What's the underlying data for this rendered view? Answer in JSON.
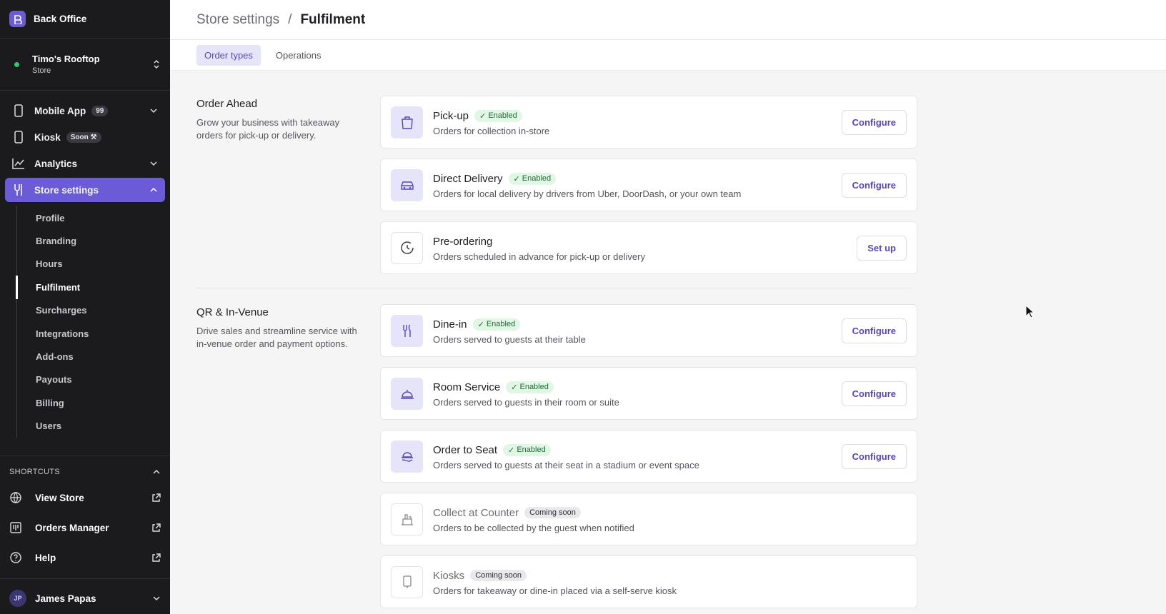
{
  "brand": {
    "name": "Back Office"
  },
  "store": {
    "name": "Timo's Rooftop",
    "type": "Store"
  },
  "nav": {
    "mobile_app": {
      "label": "Mobile App",
      "badge": "99"
    },
    "kiosk": {
      "label": "Kiosk",
      "badge": "Soon"
    },
    "analytics": {
      "label": "Analytics"
    },
    "store_settings": {
      "label": "Store settings"
    }
  },
  "subnav": [
    "Profile",
    "Branding",
    "Hours",
    "Fulfilment",
    "Surcharges",
    "Integrations",
    "Add-ons",
    "Payouts",
    "Billing",
    "Users"
  ],
  "shortcuts": {
    "header": "SHORTCUTS",
    "items": [
      "View Store",
      "Orders Manager",
      "Help"
    ]
  },
  "user": {
    "name": "James Papas",
    "initials": "JP"
  },
  "breadcrumb": {
    "parent": "Store settings",
    "separator": "/",
    "current": "Fulfilment"
  },
  "tabs": [
    "Order types",
    "Operations"
  ],
  "sections": [
    {
      "title": "Order Ahead",
      "description": "Grow your business with takeaway orders for pick-up or delivery."
    },
    {
      "title": "QR & In-Venue",
      "description": "Drive sales and streamline service with in-venue order and payment options."
    }
  ],
  "cards": [
    {
      "title": "Pick-up",
      "badge": "Enabled",
      "description": "Orders for collection in-store",
      "action": "Configure",
      "icon": "bag-icon"
    },
    {
      "title": "Direct Delivery",
      "badge": "Enabled",
      "description": "Orders for local delivery by drivers from Uber, DoorDash, or your own team",
      "action": "Configure",
      "icon": "car-icon"
    },
    {
      "title": "Pre-ordering",
      "badge": "",
      "description": "Orders scheduled in advance for pick-up or delivery",
      "action": "Set up",
      "icon": "clock-icon"
    },
    {
      "title": "Dine-in",
      "badge": "Enabled",
      "description": "Orders served to guests at their table",
      "action": "Configure",
      "icon": "utensils-icon"
    },
    {
      "title": "Room Service",
      "badge": "Enabled",
      "description": "Orders served to guests in their room or suite",
      "action": "Configure",
      "icon": "cloche-icon"
    },
    {
      "title": "Order to Seat",
      "badge": "Enabled",
      "description": "Orders served to guests at their seat in a stadium or event space",
      "action": "Configure",
      "icon": "serving-hand-icon"
    },
    {
      "title": "Collect at Counter",
      "badge": "Coming soon",
      "description": "Orders to be collected by the guest when notified",
      "action": "",
      "icon": "counter-icon"
    },
    {
      "title": "Kiosks",
      "badge": "Coming soon",
      "description": "Orders for takeaway or dine-in placed via a self-serve kiosk",
      "action": "",
      "icon": "kiosk-icon"
    }
  ],
  "colors": {
    "accent": "#6b5bd6",
    "sidebar_bg": "#1b1b1e",
    "enabled_bg": "#e2f6e6",
    "enabled_text": "#1e6b36"
  }
}
